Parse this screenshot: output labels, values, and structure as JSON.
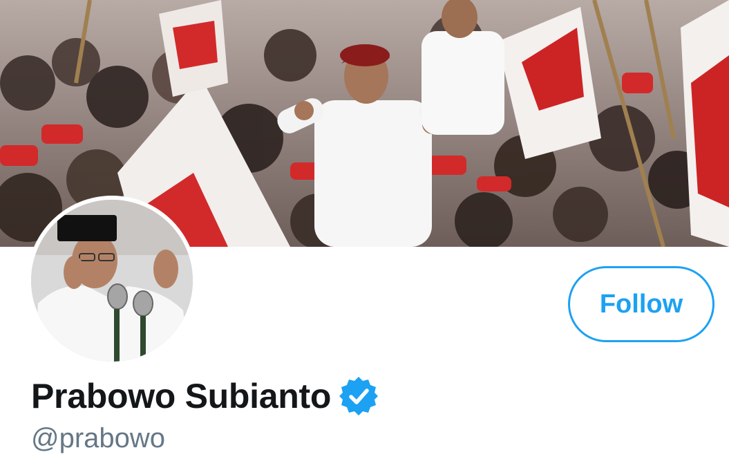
{
  "banner": {
    "image_name": "rally-crowd-banner"
  },
  "avatar": {
    "image_name": "profile-photo"
  },
  "follow": {
    "label": "Follow"
  },
  "profile": {
    "display_name": "Prabowo Subianto",
    "handle": "@prabowo",
    "verified": true
  },
  "colors": {
    "accent": "#1da1f2",
    "name_text": "#14171a",
    "handle_text": "#657786",
    "background": "#ffffff"
  }
}
